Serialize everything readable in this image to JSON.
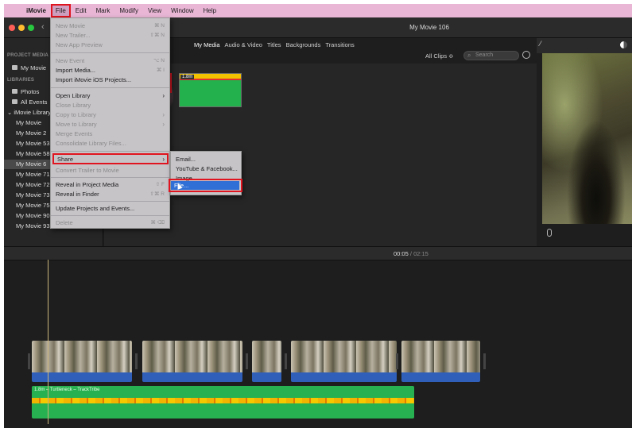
{
  "menubar": {
    "app": "iMovie",
    "items": [
      "File",
      "Edit",
      "Mark",
      "Modify",
      "View",
      "Window",
      "Help"
    ]
  },
  "window": {
    "title": "My Movie 106"
  },
  "sidebar": {
    "project_media_header": "PROJECT MEDIA",
    "project_item": "My Movie",
    "libraries_header": "LIBRARIES",
    "photos": "Photos",
    "all_events": "All Events",
    "library": "iMovie Library",
    "movies": [
      "My Movie",
      "My Movie 2",
      "My Movie 53",
      "My Movie 58",
      "My Movie 6",
      "My Movie 71",
      "My Movie 72",
      "My Movie 73",
      "My Movie 75",
      "My Movie 90",
      "My Movie 93"
    ]
  },
  "browser": {
    "tabs": [
      "My Media",
      "Audio & Video",
      "Titles",
      "Backgrounds",
      "Transitions"
    ],
    "filter": "All Clips ≎",
    "search_placeholder": "Search",
    "clip_duration": "1.8m"
  },
  "timeline": {
    "current": "00:05",
    "separator": "/",
    "total": "02:15",
    "audio_label": "1.8m – Turtleneck – TrackTribe"
  },
  "file_menu": {
    "new_movie": "New Movie",
    "new_movie_sc": "⌘ N",
    "new_trailer": "New Trailer...",
    "new_trailer_sc": "⇧⌘ N",
    "new_app_preview": "New App Preview",
    "new_event": "New Event",
    "new_event_sc": "⌥ N",
    "import_media": "Import Media...",
    "import_media_sc": "⌘ I",
    "import_ios": "Import iMovie iOS Projects...",
    "open_library": "Open Library",
    "close_library": "Close Library",
    "copy_to_library": "Copy to Library",
    "move_to_library": "Move to Library",
    "merge_events": "Merge Events",
    "consolidate": "Consolidate Library Files...",
    "share": "Share",
    "convert_trailer": "Convert Trailer to Movie",
    "reveal_project": "Reveal in Project Media",
    "reveal_project_sc": "⇧ F",
    "reveal_finder": "Reveal in Finder",
    "reveal_finder_sc": "⇧⌘ R",
    "update_projects": "Update Projects and Events...",
    "delete": "Delete",
    "delete_sc": "⌘ ⌫"
  },
  "share_submenu": {
    "email": "Email...",
    "youtube": "YouTube & Facebook...",
    "image": "Image...",
    "file": "File..."
  }
}
